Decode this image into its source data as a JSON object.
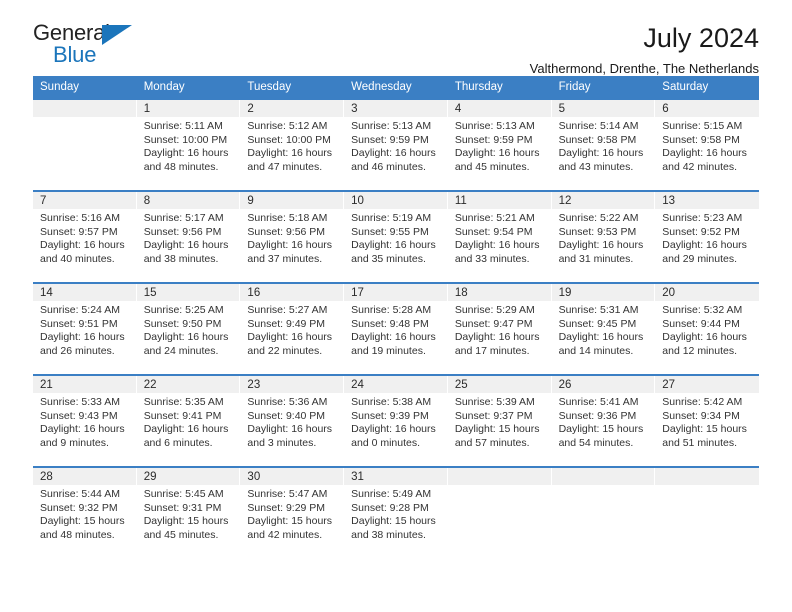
{
  "brand": {
    "name_part1": "General",
    "name_part2": "Blue",
    "accent_color": "#1b75bb"
  },
  "header": {
    "title": "July 2024",
    "subtitle": "Valthermond, Drenthe, The Netherlands",
    "header_bg_color": "#3b7fc4"
  },
  "calendar": {
    "weekdays": [
      "Sunday",
      "Monday",
      "Tuesday",
      "Wednesday",
      "Thursday",
      "Friday",
      "Saturday"
    ],
    "weeks": [
      [
        {
          "day": "",
          "lines": []
        },
        {
          "day": "1",
          "lines": [
            "Sunrise: 5:11 AM",
            "Sunset: 10:00 PM",
            "Daylight: 16 hours",
            "and 48 minutes."
          ]
        },
        {
          "day": "2",
          "lines": [
            "Sunrise: 5:12 AM",
            "Sunset: 10:00 PM",
            "Daylight: 16 hours",
            "and 47 minutes."
          ]
        },
        {
          "day": "3",
          "lines": [
            "Sunrise: 5:13 AM",
            "Sunset: 9:59 PM",
            "Daylight: 16 hours",
            "and 46 minutes."
          ]
        },
        {
          "day": "4",
          "lines": [
            "Sunrise: 5:13 AM",
            "Sunset: 9:59 PM",
            "Daylight: 16 hours",
            "and 45 minutes."
          ]
        },
        {
          "day": "5",
          "lines": [
            "Sunrise: 5:14 AM",
            "Sunset: 9:58 PM",
            "Daylight: 16 hours",
            "and 43 minutes."
          ]
        },
        {
          "day": "6",
          "lines": [
            "Sunrise: 5:15 AM",
            "Sunset: 9:58 PM",
            "Daylight: 16 hours",
            "and 42 minutes."
          ]
        }
      ],
      [
        {
          "day": "7",
          "lines": [
            "Sunrise: 5:16 AM",
            "Sunset: 9:57 PM",
            "Daylight: 16 hours",
            "and 40 minutes."
          ]
        },
        {
          "day": "8",
          "lines": [
            "Sunrise: 5:17 AM",
            "Sunset: 9:56 PM",
            "Daylight: 16 hours",
            "and 38 minutes."
          ]
        },
        {
          "day": "9",
          "lines": [
            "Sunrise: 5:18 AM",
            "Sunset: 9:56 PM",
            "Daylight: 16 hours",
            "and 37 minutes."
          ]
        },
        {
          "day": "10",
          "lines": [
            "Sunrise: 5:19 AM",
            "Sunset: 9:55 PM",
            "Daylight: 16 hours",
            "and 35 minutes."
          ]
        },
        {
          "day": "11",
          "lines": [
            "Sunrise: 5:21 AM",
            "Sunset: 9:54 PM",
            "Daylight: 16 hours",
            "and 33 minutes."
          ]
        },
        {
          "day": "12",
          "lines": [
            "Sunrise: 5:22 AM",
            "Sunset: 9:53 PM",
            "Daylight: 16 hours",
            "and 31 minutes."
          ]
        },
        {
          "day": "13",
          "lines": [
            "Sunrise: 5:23 AM",
            "Sunset: 9:52 PM",
            "Daylight: 16 hours",
            "and 29 minutes."
          ]
        }
      ],
      [
        {
          "day": "14",
          "lines": [
            "Sunrise: 5:24 AM",
            "Sunset: 9:51 PM",
            "Daylight: 16 hours",
            "and 26 minutes."
          ]
        },
        {
          "day": "15",
          "lines": [
            "Sunrise: 5:25 AM",
            "Sunset: 9:50 PM",
            "Daylight: 16 hours",
            "and 24 minutes."
          ]
        },
        {
          "day": "16",
          "lines": [
            "Sunrise: 5:27 AM",
            "Sunset: 9:49 PM",
            "Daylight: 16 hours",
            "and 22 minutes."
          ]
        },
        {
          "day": "17",
          "lines": [
            "Sunrise: 5:28 AM",
            "Sunset: 9:48 PM",
            "Daylight: 16 hours",
            "and 19 minutes."
          ]
        },
        {
          "day": "18",
          "lines": [
            "Sunrise: 5:29 AM",
            "Sunset: 9:47 PM",
            "Daylight: 16 hours",
            "and 17 minutes."
          ]
        },
        {
          "day": "19",
          "lines": [
            "Sunrise: 5:31 AM",
            "Sunset: 9:45 PM",
            "Daylight: 16 hours",
            "and 14 minutes."
          ]
        },
        {
          "day": "20",
          "lines": [
            "Sunrise: 5:32 AM",
            "Sunset: 9:44 PM",
            "Daylight: 16 hours",
            "and 12 minutes."
          ]
        }
      ],
      [
        {
          "day": "21",
          "lines": [
            "Sunrise: 5:33 AM",
            "Sunset: 9:43 PM",
            "Daylight: 16 hours",
            "and 9 minutes."
          ]
        },
        {
          "day": "22",
          "lines": [
            "Sunrise: 5:35 AM",
            "Sunset: 9:41 PM",
            "Daylight: 16 hours",
            "and 6 minutes."
          ]
        },
        {
          "day": "23",
          "lines": [
            "Sunrise: 5:36 AM",
            "Sunset: 9:40 PM",
            "Daylight: 16 hours",
            "and 3 minutes."
          ]
        },
        {
          "day": "24",
          "lines": [
            "Sunrise: 5:38 AM",
            "Sunset: 9:39 PM",
            "Daylight: 16 hours",
            "and 0 minutes."
          ]
        },
        {
          "day": "25",
          "lines": [
            "Sunrise: 5:39 AM",
            "Sunset: 9:37 PM",
            "Daylight: 15 hours",
            "and 57 minutes."
          ]
        },
        {
          "day": "26",
          "lines": [
            "Sunrise: 5:41 AM",
            "Sunset: 9:36 PM",
            "Daylight: 15 hours",
            "and 54 minutes."
          ]
        },
        {
          "day": "27",
          "lines": [
            "Sunrise: 5:42 AM",
            "Sunset: 9:34 PM",
            "Daylight: 15 hours",
            "and 51 minutes."
          ]
        }
      ],
      [
        {
          "day": "28",
          "lines": [
            "Sunrise: 5:44 AM",
            "Sunset: 9:32 PM",
            "Daylight: 15 hours",
            "and 48 minutes."
          ]
        },
        {
          "day": "29",
          "lines": [
            "Sunrise: 5:45 AM",
            "Sunset: 9:31 PM",
            "Daylight: 15 hours",
            "and 45 minutes."
          ]
        },
        {
          "day": "30",
          "lines": [
            "Sunrise: 5:47 AM",
            "Sunset: 9:29 PM",
            "Daylight: 15 hours",
            "and 42 minutes."
          ]
        },
        {
          "day": "31",
          "lines": [
            "Sunrise: 5:49 AM",
            "Sunset: 9:28 PM",
            "Daylight: 15 hours",
            "and 38 minutes."
          ]
        },
        {
          "day": "",
          "lines": []
        },
        {
          "day": "",
          "lines": []
        },
        {
          "day": "",
          "lines": []
        }
      ]
    ]
  }
}
